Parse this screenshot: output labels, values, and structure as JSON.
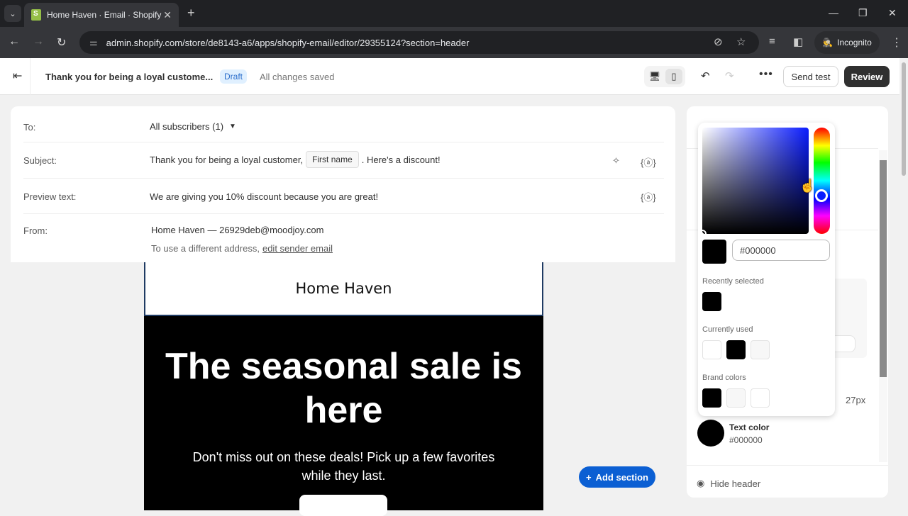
{
  "browser": {
    "tab_title": "Home Haven · Email · Shopify",
    "url": "admin.shopify.com/store/de8143-a6/apps/shopify-email/editor/29355124?section=header",
    "incognito_label": "Incognito"
  },
  "topbar": {
    "title": "Thank you for being a loyal custome...",
    "status_badge": "Draft",
    "save_status": "All changes saved",
    "send_test_label": "Send test",
    "review_label": "Review"
  },
  "fields": {
    "to_label": "To:",
    "to_value": "All subscribers (1)",
    "subject_label": "Subject:",
    "subject_prefix": "Thank you for being a loyal customer,",
    "subject_chip": "First name",
    "subject_suffix": ". Here's a discount!",
    "preview_label": "Preview text:",
    "preview_value": "We are giving you 10% discount because you are great!",
    "from_label": "From:",
    "from_value": "Home Haven — 26929deb@moodjoy.com",
    "from_hint": "To use a different address,",
    "from_link": "edit sender email"
  },
  "email": {
    "header_brand": "Home Haven",
    "hero_title": "The seasonal sale is here",
    "hero_body": "Don't miss out on these deals! Pick up a few favorites while they last."
  },
  "canvas": {
    "add_section_label": "Add section"
  },
  "picker": {
    "hex_value": "#000000",
    "hue_position": 0.64,
    "recently_selected_label": "Recently selected",
    "recently_selected": [
      "#000000"
    ],
    "currently_used_label": "Currently used",
    "currently_used": [
      "#ffffff",
      "#000000",
      "#f7f7f7"
    ],
    "brand_colors_label": "Brand colors",
    "brand_colors": [
      "#000000",
      "#f7f7f7",
      "#ffffff"
    ]
  },
  "panel": {
    "size_value": "27px",
    "text_color_label": "Text color",
    "text_color_value": "#000000",
    "hide_header_label": "Hide header"
  }
}
